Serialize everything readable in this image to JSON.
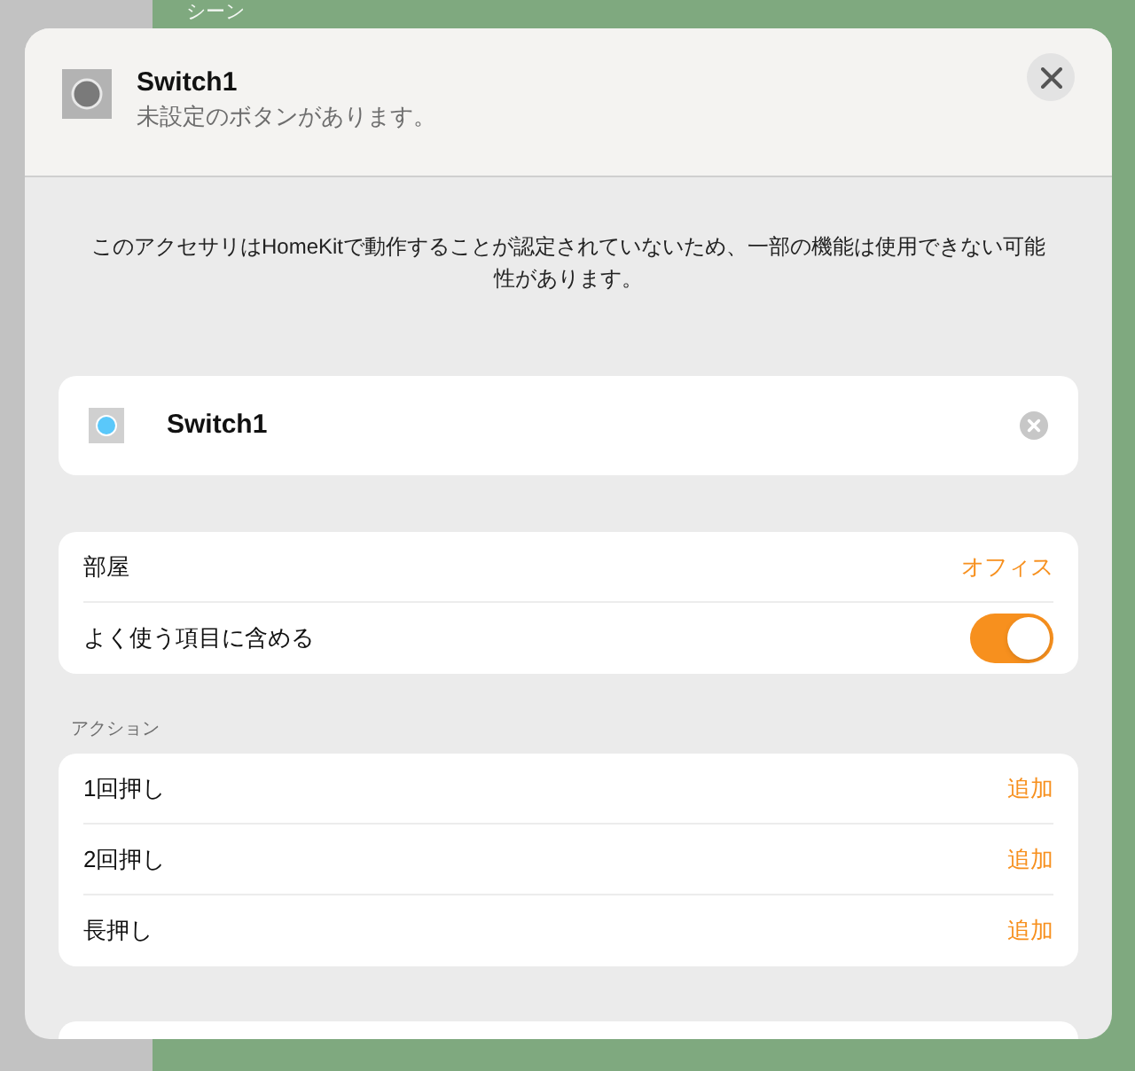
{
  "background": {
    "section_label": "シーン"
  },
  "header": {
    "title": "Switch1",
    "subtitle": "未設定のボタンがあります。"
  },
  "notice": "このアクセサリはHomeKitで動作することが認定されていないため、一部の機能は使用できない可能性があります。",
  "accessory": {
    "name": "Switch1"
  },
  "settings": [
    {
      "kind": "value",
      "label": "部屋",
      "value": "オフィス"
    },
    {
      "kind": "toggle",
      "label": "よく使う項目に含める",
      "on": true
    }
  ],
  "actions": {
    "title": "アクション",
    "rows": [
      {
        "label": "1回押し",
        "action": "追加"
      },
      {
        "label": "2回押し",
        "action": "追加"
      },
      {
        "label": "長押し",
        "action": "追加"
      }
    ]
  }
}
